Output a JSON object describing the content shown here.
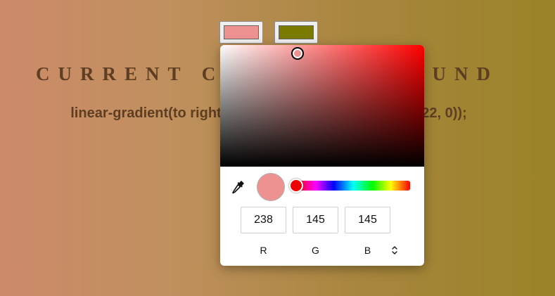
{
  "heading": "CURRENT CSS BACKGROUND",
  "gradient_css": "linear-gradient(to right, rgb(238, 145, 145), rgb(122, 122, 0));",
  "swatches": [
    {
      "name": "left",
      "color": "#ee9191",
      "active": true
    },
    {
      "name": "right",
      "color": "#7a7a00",
      "active": false
    }
  ],
  "picker": {
    "hue_color": "#ff0000",
    "selected_color": "#ee9191",
    "rgb": {
      "r": "238",
      "g": "145",
      "b": "145"
    },
    "labels": {
      "r": "R",
      "g": "G",
      "b": "B"
    },
    "mode_icon": "up-down-chevrons-icon",
    "eyedropper_icon": "eyedropper-icon"
  }
}
